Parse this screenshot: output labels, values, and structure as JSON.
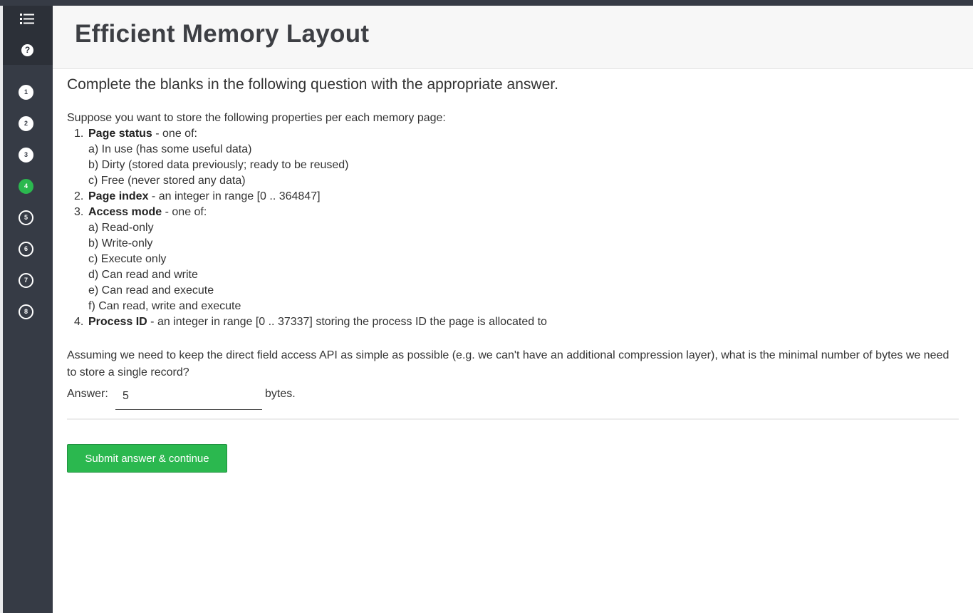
{
  "page": {
    "title": "Efficient Memory Layout"
  },
  "sidebar": {
    "menu_icon": "list-icon",
    "help_icon": "question-icon",
    "help_label": "?",
    "steps": [
      {
        "label": "1",
        "state": "done"
      },
      {
        "label": "2",
        "state": "done"
      },
      {
        "label": "3",
        "state": "done"
      },
      {
        "label": "4",
        "state": "active"
      },
      {
        "label": "5",
        "state": "pending"
      },
      {
        "label": "6",
        "state": "pending"
      },
      {
        "label": "7",
        "state": "pending"
      },
      {
        "label": "8",
        "state": "pending"
      }
    ]
  },
  "content": {
    "instruction": "Complete the blanks in the following question with the appropriate answer.",
    "intro": "Suppose you want to store the following properties per each memory page:",
    "properties": [
      {
        "num": "1.",
        "name": "Page status",
        "desc": " - one of:",
        "options": [
          "a) In use (has some useful data)",
          "b) Dirty (stored data previously; ready to be reused)",
          "c) Free (never stored any data)"
        ]
      },
      {
        "num": "2.",
        "name": "Page index",
        "desc": " - an integer in range [0 .. 364847]",
        "options": []
      },
      {
        "num": "3.",
        "name": "Access mode",
        "desc": " - one of:",
        "options": [
          "a) Read-only",
          "b) Write-only",
          "c) Execute only",
          "d) Can read and write",
          "e) Can read and execute",
          "f) Can read, write and execute"
        ]
      },
      {
        "num": "4.",
        "name": "Process ID",
        "desc": " - an integer in range [0 .. 37337] storing the process ID the page is allocated to",
        "options": []
      }
    ],
    "question": "Assuming we need to keep the direct field access API as simple as possible (e.g. we can't have an additional compression layer), what is the minimal number of bytes we need to store a single record?",
    "answer_label": "Answer:",
    "answer_value": "5",
    "answer_unit": "bytes.",
    "submit_label": "Submit answer & continue"
  },
  "colors": {
    "sidebar": "#363b45",
    "accent_green": "#2bb84f",
    "header_bg": "#f7f7f7"
  }
}
